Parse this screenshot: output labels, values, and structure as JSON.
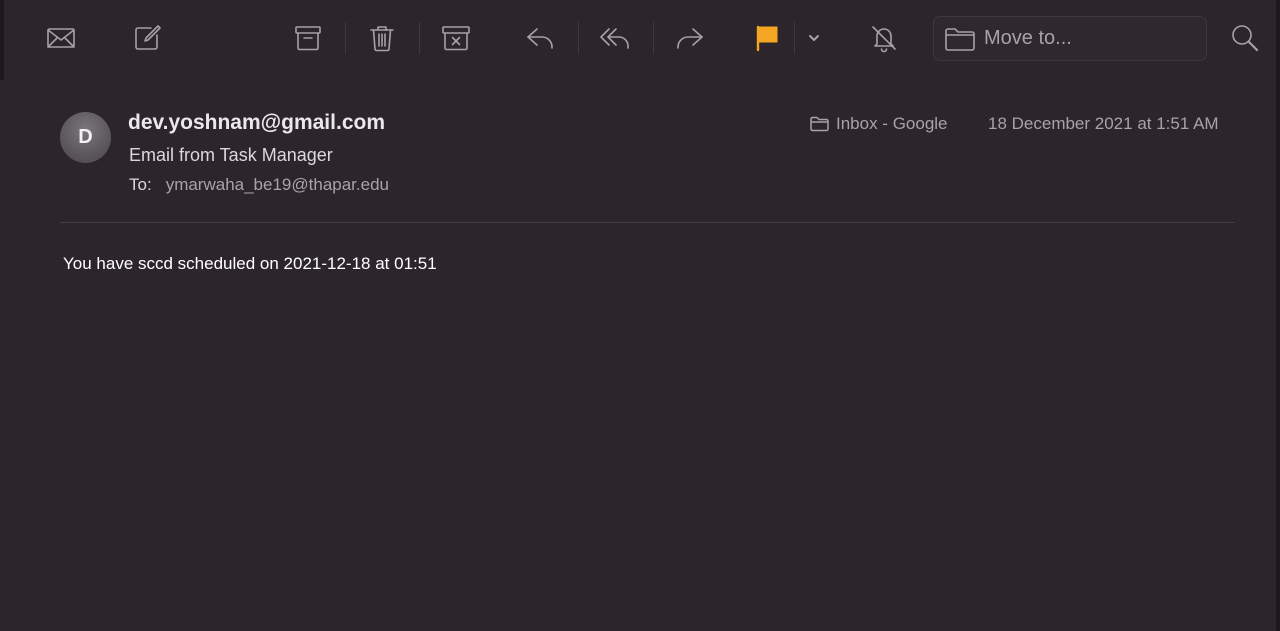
{
  "toolbar": {
    "buttons": [
      {
        "name": "get-mail",
        "icon": "envelope-icon"
      },
      {
        "name": "compose",
        "icon": "compose-icon"
      },
      {
        "name": "archive",
        "icon": "archive-icon"
      },
      {
        "name": "delete",
        "icon": "trash-icon"
      },
      {
        "name": "junk",
        "icon": "junk-icon"
      },
      {
        "name": "reply",
        "icon": "reply-icon"
      },
      {
        "name": "reply-all",
        "icon": "reply-all-icon"
      },
      {
        "name": "forward",
        "icon": "forward-icon"
      },
      {
        "name": "flag",
        "icon": "flag-icon",
        "color": "#f5a623"
      },
      {
        "name": "mute",
        "icon": "bell-slash-icon"
      },
      {
        "name": "search",
        "icon": "search-icon"
      }
    ],
    "move_to_placeholder": "Move to..."
  },
  "message": {
    "avatar_initial": "D",
    "sender": "dev.yoshnam@gmail.com",
    "subject": "Email from Task Manager",
    "to_label": "To:",
    "to_address": "ymarwaha_be19@thapar.edu",
    "mailbox": "Inbox - Google",
    "date": "18 December 2021 at 1:51 AM",
    "body": "You have sccd scheduled on 2021-12-18 at 01:51"
  },
  "colors": {
    "background": "#2c252b",
    "flag": "#f5a623",
    "icon": "#a7a2a6"
  }
}
